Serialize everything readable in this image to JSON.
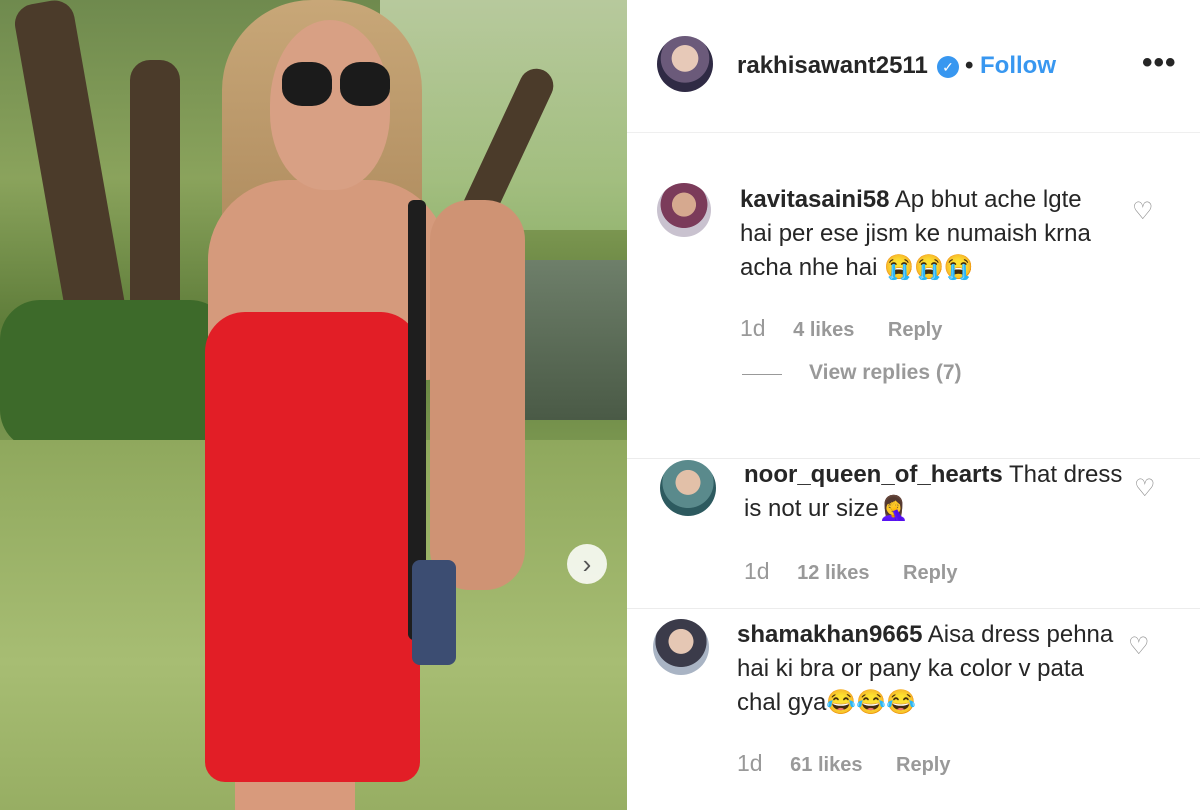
{
  "post": {
    "username": "rakhisawant2511",
    "verified": true,
    "separator": "•",
    "follow_label": "Follow",
    "more_label": "•••",
    "next_label": "›"
  },
  "comments": [
    {
      "username": "kavitasaini58",
      "text": "Ap bhut ache lgte hai per ese jism ke numaish krna acha nhe hai 😭😭😭",
      "time": "1d",
      "likes": "4 likes",
      "reply": "Reply",
      "view_replies": "View replies (7)"
    },
    {
      "username": "noor_queen_of_hearts",
      "text": "That dress is not ur size🤦‍♀️",
      "time": "1d",
      "likes": "12 likes",
      "reply": "Reply"
    },
    {
      "username": "shamakhan9665",
      "text": "Aisa dress pehna hai ki bra or pany ka color v pata chal gya😂😂😂",
      "time": "1d",
      "likes": "61 likes",
      "reply": "Reply"
    }
  ],
  "icons": {
    "heart": "heart-icon",
    "verified": "verified-badge-icon",
    "more": "more-options-icon",
    "next": "chevron-right-icon"
  },
  "colors": {
    "accent": "#3897f0",
    "dress": "#e21e26",
    "text": "#262626",
    "muted": "#999999"
  }
}
